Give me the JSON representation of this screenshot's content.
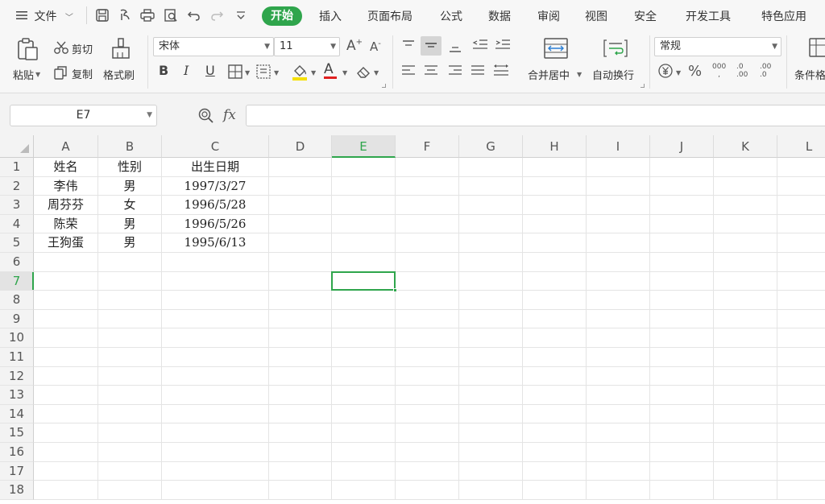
{
  "menubar": {
    "file_label": "文件",
    "tabs": [
      "开始",
      "插入",
      "页面布局",
      "公式",
      "数据",
      "审阅",
      "视图",
      "安全",
      "开发工具",
      "特色应用"
    ],
    "active_tab": "开始"
  },
  "ribbon": {
    "paste": "粘贴",
    "cut": "剪切",
    "copy": "复制",
    "format_painter": "格式刷",
    "font_name": "宋体",
    "font_size": "11",
    "bold": "B",
    "italic": "I",
    "underline": "U",
    "font_color_letter": "A",
    "merge_center": "合并居中",
    "wrap_text": "自动换行",
    "number_format": "常规",
    "percent": "%",
    "thousands": "000",
    "inc_decimal": ".0 .00",
    "dec_decimal": ".00 .0",
    "conditional_format": "条件格",
    "grow_font": "A",
    "shrink_font": "A"
  },
  "formula_bar": {
    "name_box": "E7",
    "fx": "fx",
    "value": ""
  },
  "grid": {
    "columns": [
      "A",
      "B",
      "C",
      "D",
      "E",
      "F",
      "G",
      "H",
      "I",
      "J",
      "K",
      "L"
    ],
    "rows": [
      "1",
      "2",
      "3",
      "4",
      "5",
      "6",
      "7",
      "8",
      "9",
      "10",
      "11",
      "12",
      "13",
      "14",
      "15",
      "16",
      "17",
      "18"
    ],
    "selected_cell": "E7",
    "cells": [
      [
        "姓名",
        "性别",
        "出生日期"
      ],
      [
        "李伟",
        "男",
        "1997/3/27"
      ],
      [
        "周芬芬",
        "女",
        "1996/5/28"
      ],
      [
        "陈荣",
        "男",
        "1996/5/26"
      ],
      [
        "王狗蛋",
        "男",
        "1995/6/13"
      ]
    ]
  },
  "colors": {
    "accent": "#2fa54c",
    "font_color_bar": "#e02020",
    "fill_color_bar": "#f5e000"
  }
}
